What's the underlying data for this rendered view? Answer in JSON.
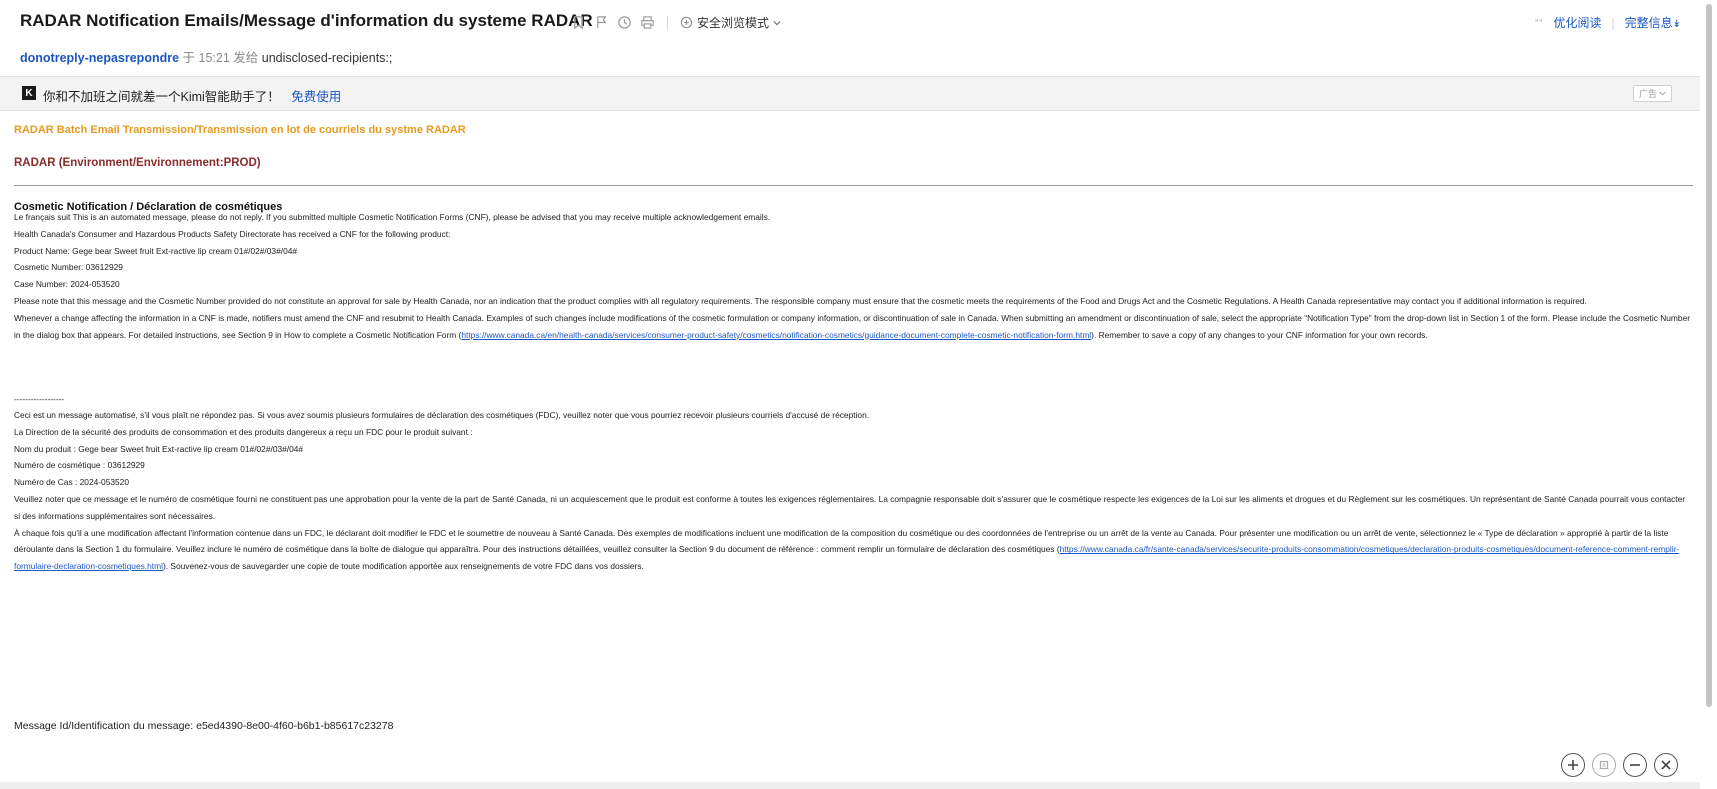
{
  "header": {
    "subject": "RADAR Notification Emails/Message d'information du systeme RADAR",
    "safe_mode": "安全浏览模式",
    "more_dots": "\"\"",
    "optimize_read": "优化阅读",
    "full_info": "完整信息",
    "sender": "donotreply-nepasrepondre",
    "time_prefix": "于 15:21 发给",
    "recipients": "undisclosed-recipients:;"
  },
  "ad": {
    "logo": "K",
    "text": "你和不加班之间就差一个Kimi智能助手了！",
    "link": "免费使用",
    "tag": "广告"
  },
  "email": {
    "banner": "RADAR Batch Email Transmission/Transmission en lot de courriels du systme RADAR",
    "env": "RADAR (Environment/Environnement:PROD)",
    "heading": "Cosmetic Notification / Déclaration de cosmétiques",
    "en": {
      "l1": "Le français suit This is an automated message, please do not reply. If you submitted multiple Cosmetic Notification Forms (CNF), please be advised that you may receive multiple acknowledgement emails.",
      "l2": "Health Canada's Consumer and Hazardous Products Safety Directorate has received a CNF for the following product:",
      "l3": "Product Name: Gege bear Sweet fruit Ext-ractive lip cream 01#/02#/03#/04#",
      "l4": "Cosmetic Number: 03612929",
      "l5": "Case Number: 2024-053520",
      "l6": "Please note that this message and the Cosmetic Number provided do not constitute an approval for sale by Health Canada, nor an indication that the product complies with all regulatory requirements. The responsible company must ensure that the cosmetic meets the requirements of the Food and Drugs Act and the Cosmetic Regulations. A Health Canada representative may contact you if additional information is required.",
      "l7a": "Whenever a change affecting the information in a CNF is made, notifiers must amend the CNF and resubmit to Health Canada. Examples of such changes include modifications of the cosmetic formulation or company information, or discontinuation of sale in Canada. When submitting an amendment or discontinuation of sale, select the appropriate “Notification Type” from the drop-down list in Section 1 of the form. Please include the Cosmetic Number in the dialog box that appears. For detailed instructions, see Section 9 in How to complete a Cosmetic Notification Form (",
      "l7link": "https://www.canada.ca/en/health-canada/services/consumer-product-safety/cosmetics/notification-cosmetics/guidance-document-complete-cosmetic-notification-form.html",
      "l7b": "). Remember to save a copy of any changes to your CNF information for your own records."
    },
    "divider": "------------------",
    "fr": {
      "l1": "Ceci est un message automatisé, s'il vous plaît ne répondez pas. Si vous avez soumis plusieurs formulaires de déclaration des cosmétiques (FDC), veuillez noter que vous pourriez recevoir plusieurs courriels d'accusé de réception.",
      "l2": "La Direction de la sécurité des produits de consommation et des produits dangereux a reçu un FDC pour le produit suivant :",
      "l3": "Nom du produit : Gege bear Sweet fruit Ext-ractive lip cream 01#/02#/03#/04#",
      "l4": "Numéro de cosmétique : 03612929",
      "l5": "Numéro de Cas : 2024-053520",
      "l6": "Veuillez noter que ce message et le numéro de cosmétique fourni ne constituent pas une approbation pour la vente de la part de Santé Canada, ni un acquiescement que le produit est conforme à toutes les exigences réglementaires. La compagnie responsable doit s'assurer que le cosmétique respecte les exigences de la Loi sur les aliments et drogues et du Règlement sur les cosmétiques. Un représentant de Santé Canada pourrait vous contacter si des informations supplémentaires sont nécessaires.",
      "l7a": "À chaque fois qu'il a une modification affectant l'information contenue dans un FDC, le déclarant doit modifier le FDC et le soumettre de nouveau à Santé Canada. Des exemples de modifications incluent une modification de la composition du cosmétique ou des coordonnées de l'entreprise ou un arrêt de la vente au Canada. Pour présenter une modification ou un arrêt de vente, sélectionnez le « Type de déclaration » approprié à partir de la liste déroulante dans la Section 1 du formulaire. Veuillez inclure le numéro de cosmétique dans la boîte de dialogue qui apparaîtra. Pour des instructions détaillées, veuillez consulter la Section 9 du document de référence : comment remplir un formulaire de déclaration des cosmétiques (",
      "l7link": "https://www.canada.ca/fr/sante-canada/services/securite-produits-consommation/cosmetiques/declaration-produits-cosmetiques/document-reference-comment-remplir-formulaire-declaration-cosmetiques.html",
      "l7b": "). Souvenez-vous de sauvegarder une copie de toute modification apportée aux renseignements de votre FDC dans vos dossiers."
    },
    "message_id": "Message Id/Identification du message: e5ed4390-8e00-4f60-b6b1-b85617c23278"
  },
  "icons": {
    "toolbar": [
      "bookmark-icon",
      "flag-icon",
      "clock-icon",
      "print-icon"
    ],
    "safe_mode": "shield-plus-icon",
    "float": [
      "zoom-in-icon",
      "fit-icon",
      "zoom-out-icon",
      "close-icon"
    ]
  }
}
